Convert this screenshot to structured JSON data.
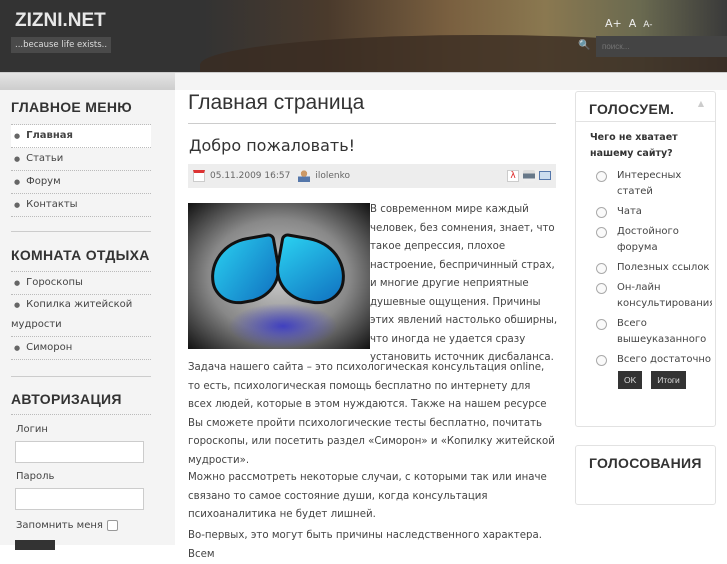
{
  "header": {
    "site_name": "ZIZNI.NET",
    "tagline": "...because life exists..",
    "font_increase": "A+",
    "font_reset": "A",
    "font_decrease": "A-",
    "search_placeholder": "поиск..."
  },
  "left": {
    "main_menu": {
      "title": "ГЛАВНОЕ МЕНЮ",
      "items": [
        "Главная",
        "Статьи",
        "Форум",
        "Контакты"
      ]
    },
    "rest_room": {
      "title": "КОМНАТА ОТДЫХА",
      "items": [
        "Гороскопы",
        "Копилка житейской",
        "мудрости",
        "Симорон"
      ]
    },
    "auth": {
      "title": "АВТОРИЗАЦИЯ",
      "login_label": "Логин",
      "password_label": "Пароль",
      "remember_label": "Запомнить меня"
    }
  },
  "main": {
    "page_title": "Главная страница",
    "article_title": "Добро пожаловать!",
    "date": "05.11.2009 16:57",
    "author": "ilolenko",
    "p1": "В современном мире каждый человек, без сомнения, знает, что такое депрессия, плохое настроение, беспричинный страх, и многие другие неприятные душевные ощущения. Причины этих явлений настолько обширны, что иногда не удается сразу установить источник дисбаланса.",
    "p2": "Задача нашего сайта – это психологическая консультация online, то есть, психологическая помощь бесплатно по интернету для всех людей, которые в этом нуждаются. Также на нашем ресурсе Вы сможете пройти психологические тесты бесплатно, почитать гороскопы, или посетить раздел «Симорон» и «Копилку житейской мудрости».",
    "p3": "Можно рассмотреть некоторые случаи, с которыми так или иначе связано то самое состояние души, когда консультация психоаналитика не будет лишней.",
    "p4": "Во-первых, это могут быть причины наследственного характера. Всем"
  },
  "right": {
    "poll": {
      "title": "ГОЛОСУЕМ.",
      "question": "Чего не хватает нашему сайту?",
      "options": [
        "Интересных статей",
        "Чата",
        "Достойного форума",
        "Полезных ссылок",
        "Он-лайн консультирования",
        "Всего вышеуказанного",
        "Всего достаточно"
      ],
      "vote_label": "OK",
      "results_label": "Итоги"
    },
    "polls_title": "ГОЛОСОВАНИЯ"
  }
}
